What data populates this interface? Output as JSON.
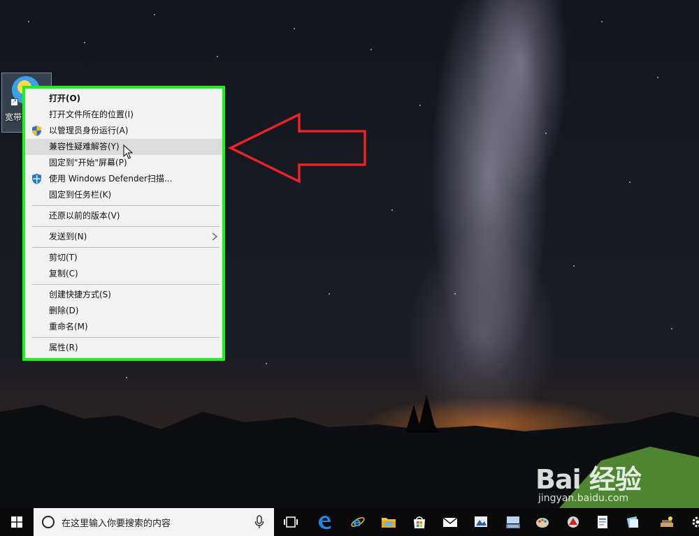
{
  "desktop": {
    "icon_label": "宽带",
    "shortcut_arrow": "↗"
  },
  "context_menu": {
    "items": [
      {
        "label": "打开(O)"
      },
      {
        "label": "打开文件所在的位置(I)"
      },
      {
        "label": "以管理员身份运行(A)"
      },
      {
        "label": "兼容性疑难解答(Y)"
      },
      {
        "label": "固定到\"开始\"屏幕(P)"
      },
      {
        "label": "使用 Windows Defender扫描..."
      },
      {
        "label": "固定到任务栏(K)"
      },
      {
        "label": "还原以前的版本(V)"
      },
      {
        "label": "发送到(N)"
      },
      {
        "label": "剪切(T)"
      },
      {
        "label": "复制(C)"
      },
      {
        "label": "创建快捷方式(S)"
      },
      {
        "label": "删除(D)"
      },
      {
        "label": "重命名(M)"
      },
      {
        "label": "属性(R)"
      }
    ],
    "highlighted_item": "兼容性疑难解答(Y)",
    "border_color": "#19f51a"
  },
  "annotation": {
    "arrow_color": "#e8232a",
    "arrow_icon": "left-arrow-outline"
  },
  "watermark": {
    "logo": "Bai 经验",
    "url": "jingyan.baidu.com"
  },
  "taskbar": {
    "search_placeholder": "在这里输入你要搜索的内容",
    "icons": [
      "windows-logo-icon",
      "task-view-icon",
      "edge-icon",
      "ie-icon",
      "file-explorer-icon",
      "store-icon",
      "mail-icon",
      "photo-icon",
      "keyboard-icon",
      "paint-icon",
      "app-icon",
      "doc-icon",
      "folder-icon",
      "sound-icon",
      "settings-icon"
    ]
  }
}
